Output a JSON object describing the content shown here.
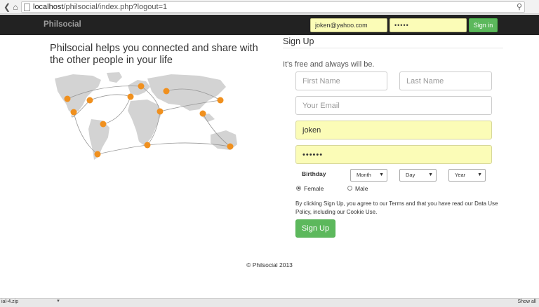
{
  "browser": {
    "url_host": "localhost",
    "url_path": "/philsocial/index.php?logout=1",
    "icons": [
      "back-icon",
      "forward-icon",
      "home-icon",
      "page-icon",
      "search-icon"
    ]
  },
  "navbar": {
    "brand": "Philsocial",
    "login_email_value": "joken@yahoo.com",
    "login_password_value": "•••••",
    "signin_label": "Sign in"
  },
  "hero": {
    "tagline": "Philsocial helps you connected and share with the other people in your life"
  },
  "signup": {
    "title": "Sign Up",
    "subtitle": "It's free and always will be.",
    "first_name_placeholder": "First Name",
    "last_name_placeholder": "Last Name",
    "email_placeholder": "Your Email",
    "username_value": "joken",
    "password_value": "••••••",
    "birthday_label": "Birthday",
    "month_select": "Month",
    "day_select": "Day",
    "year_select": "Year",
    "gender_female": "Female",
    "gender_male": "Male",
    "terms": "By clicking Sign Up, you agree to our Terms and that you have read our Data Use Policy, including our Cookie Use.",
    "button_label": "Sign Up"
  },
  "footer": {
    "copyright": "© Philsocial 2013"
  },
  "download_bar": {
    "item": "ial-4.zip",
    "show_all": "Show all"
  },
  "colors": {
    "navbar_bg": "#222222",
    "success_green": "#5cb85c",
    "autofill_yellow": "#fbfcb7",
    "map_land": "#d3d3d3",
    "map_dot": "#f0901e"
  }
}
